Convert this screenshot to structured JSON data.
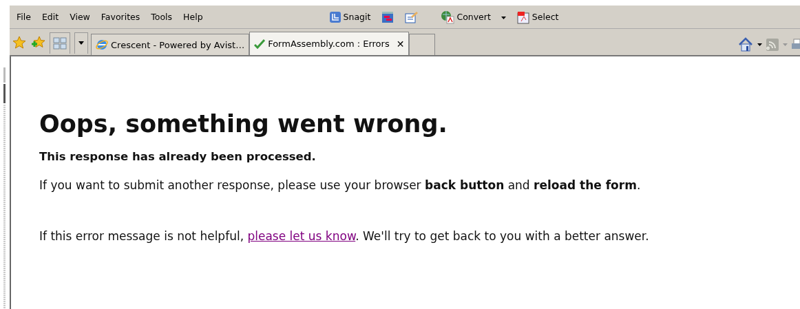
{
  "menu": [
    "File",
    "Edit",
    "View",
    "Favorites",
    "Tools",
    "Help"
  ],
  "toolbar": [
    {
      "kind": "snagit",
      "label": "Snagit"
    },
    {
      "kind": "icon1"
    },
    {
      "kind": "icon2"
    },
    {
      "kind": "convert",
      "label": "Convert"
    },
    {
      "kind": "select",
      "label": "Select"
    }
  ],
  "tabs": [
    {
      "label": "Crescent - Powered by Avist…",
      "selected": false,
      "kind": "ie"
    },
    {
      "label": "FormAssembly.com : Errors",
      "selected": true,
      "kind": "check",
      "close": "✕"
    },
    {
      "selected": false,
      "kind": "new"
    }
  ],
  "page": {
    "heading": "Oops, something went wrong.",
    "notice": "This response has already been processed.",
    "instructions": "If you want to submit another response, please use your browser **back button** and **reload the form**.",
    "help_before": "If this error message is not helpful, ",
    "help_link": "please let us know",
    "help_after": ". We'll try to get back to you with a better answer."
  }
}
